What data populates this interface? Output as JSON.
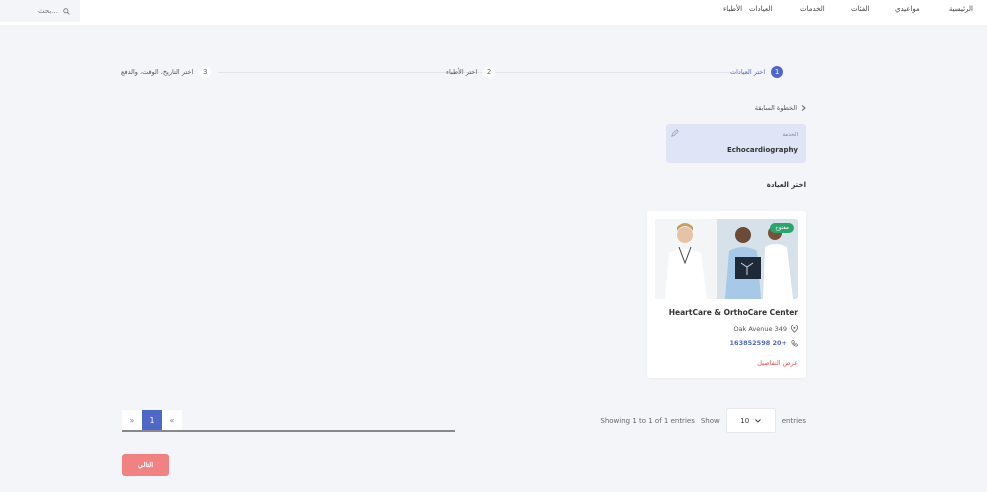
{
  "header": {
    "search_placeholder": "بحث...",
    "nav": {
      "home": "الرئيسية",
      "appointments": "مواعيدي",
      "categories": "الفئات",
      "services": "الخدمات",
      "clinics": "العيادات",
      "doctors": "الأطباء"
    }
  },
  "steps": [
    {
      "num": "1",
      "label": "اختر العيادات"
    },
    {
      "num": "2",
      "label": "اختر الأطباء"
    },
    {
      "num": "3",
      "label": "اختر التاريخ، الوقت، والدفع"
    }
  ],
  "back_label": "الخطوة السابقة",
  "selected_service": {
    "label": "الخدمة",
    "value": "Echocardiography"
  },
  "section_title": "اختر العيادة",
  "clinic": {
    "status": "مفتوح",
    "name": "HeartCare & OrthoCare Center",
    "address": "Oak Avenue 349",
    "phone": "163852598 20+",
    "details_link": "عرض التفاصيل"
  },
  "pagination": {
    "prev": "«",
    "current": "1",
    "next": "»"
  },
  "entries": {
    "showing": "Showing 1 to 1 of 1 entries",
    "show_label": "Show",
    "value": "10",
    "suffix": "entries"
  },
  "next_button": "التالي",
  "colors": {
    "accent": "#4f67c9",
    "danger": "#f28282",
    "open": "#2aa56d"
  }
}
